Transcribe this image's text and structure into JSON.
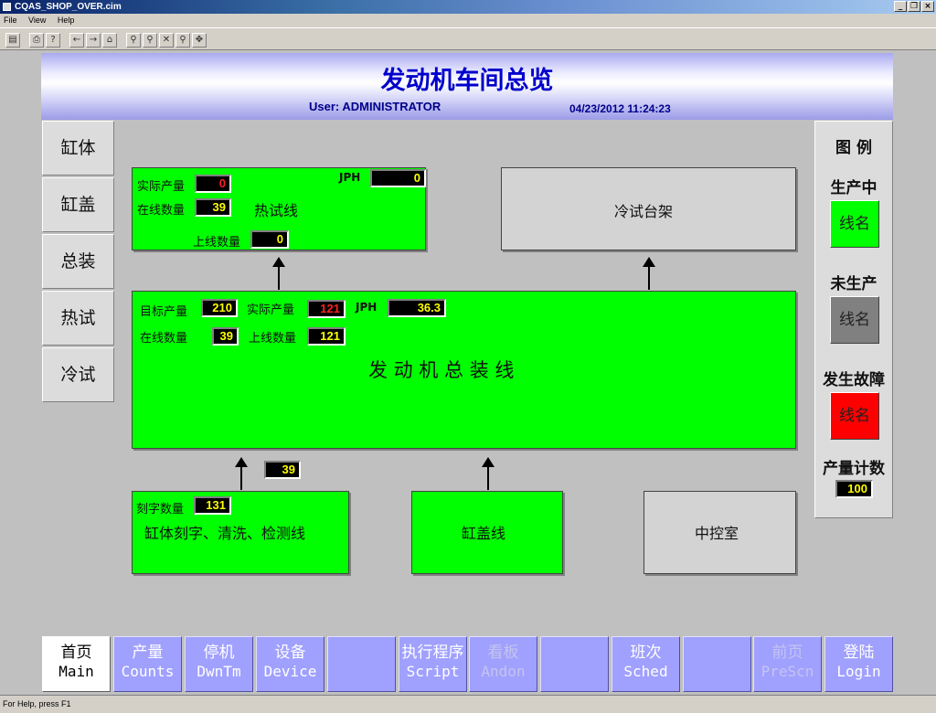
{
  "window": {
    "title": "CQAS_SHOP_OVER.cim"
  },
  "menu": [
    "File",
    "View",
    "Help"
  ],
  "header": {
    "title": "发动机车间总览",
    "user": "User: ADMINISTRATOR",
    "datetime": "04/23/2012 11:24:23"
  },
  "side_nav": [
    "缸体",
    "缸盖",
    "总装",
    "热试",
    "冷试"
  ],
  "hot_test": {
    "actual_label": "实际产量",
    "actual_value": "0",
    "jph_label": "JPH",
    "jph_value": "0",
    "online_label": "在线数量",
    "online_value": "39",
    "name": "热试线",
    "upline_label": "上线数量",
    "upline_value": "0"
  },
  "cold_test": {
    "name": "冷试台架"
  },
  "assembly": {
    "target_label": "目标产量",
    "target_value": "210",
    "actual_label": "实际产量",
    "actual_value": "121",
    "jph_label": "JPH",
    "jph_value": "36.3",
    "online_label": "在线数量",
    "online_value": "39",
    "upline_label": "上线数量",
    "upline_value": "121",
    "name": "发 动 机 总 装 线"
  },
  "block_to_assembly_value": "39",
  "block_line": {
    "engrave_label": "刻字数量",
    "engrave_value": "131",
    "name": "缸体刻字、清洗、检测线"
  },
  "head_line": {
    "name": "缸盖线"
  },
  "control_room": {
    "name": "中控室"
  },
  "legend": {
    "title": "图 例",
    "producing_label": "生产中",
    "idle_label": "未生产",
    "fault_label": "发生故障",
    "box_text": "线名",
    "count_label": "产量计数",
    "count_value": "100",
    "colors": {
      "producing": "#00ff00",
      "idle": "#808080",
      "fault": "#ff0000"
    }
  },
  "bottom_nav": [
    {
      "cn": "首页",
      "en": "Main",
      "state": "active"
    },
    {
      "cn": "产量",
      "en": "Counts",
      "state": "normal"
    },
    {
      "cn": "停机",
      "en": "DwnTm",
      "state": "normal"
    },
    {
      "cn": "设备",
      "en": "Device",
      "state": "normal"
    },
    {
      "cn": "",
      "en": "",
      "state": "normal"
    },
    {
      "cn": "执行程序",
      "en": "Script",
      "state": "normal"
    },
    {
      "cn": "看板",
      "en": "Andon",
      "state": "disabled"
    },
    {
      "cn": "",
      "en": "",
      "state": "normal"
    },
    {
      "cn": "班次",
      "en": "Sched",
      "state": "normal"
    },
    {
      "cn": "",
      "en": "",
      "state": "normal"
    },
    {
      "cn": "前页",
      "en": "PreScn",
      "state": "disabled"
    },
    {
      "cn": "登陆",
      "en": "Login",
      "state": "normal"
    }
  ],
  "status_bar": "For Help, press F1"
}
